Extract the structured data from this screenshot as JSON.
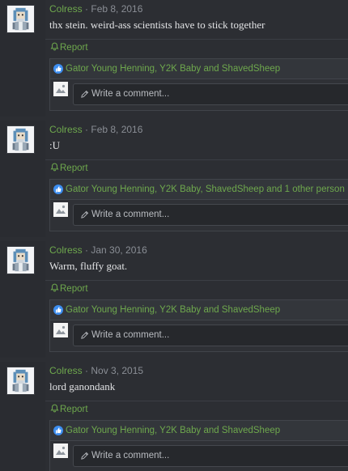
{
  "posts": [
    {
      "author": "Colress",
      "date": "Feb 8, 2016",
      "message": "thx stein. weird-ass scientists have to stick together",
      "report_label": "Report",
      "likes_text": "Gator Young Henning, Y2K Baby and ShavedSheep",
      "comment_placeholder": "Write a comment..."
    },
    {
      "author": "Colress",
      "date": "Feb 8, 2016",
      "message": ":U",
      "report_label": "Report",
      "likes_text": "Gator Young Henning, Y2K Baby, ShavedSheep and 1 other person",
      "comment_placeholder": "Write a comment..."
    },
    {
      "author": "Colress",
      "date": "Jan 30, 2016",
      "message": "Warm, fluffy goat.",
      "report_label": "Report",
      "likes_text": "Gator Young Henning, Y2K Baby and ShavedSheep",
      "comment_placeholder": "Write a comment..."
    },
    {
      "author": "Colress",
      "date": "Nov 3, 2015",
      "message": "lord ganondank",
      "report_label": "Report",
      "likes_text": "Gator Young Henning, Y2K Baby and ShavedSheep",
      "comment_placeholder": "Write a comment..."
    }
  ],
  "meta_separator": " · ",
  "icons": {
    "avatar": "pixel-character-avatar",
    "report": "bell-icon",
    "like": "thumbs-up-icon",
    "comment": "pencil-icon"
  },
  "colors": {
    "accent": "#6ea84d",
    "like_badge": "#3d8ef0",
    "background": "#2c2e33",
    "text": "#e2e3e5"
  }
}
